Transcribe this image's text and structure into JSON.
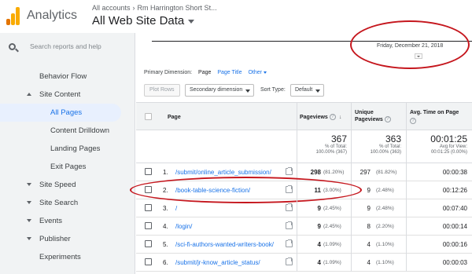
{
  "header": {
    "app_title": "Analytics",
    "account_crumb": "All accounts",
    "property_crumb": "Rm Harrington Short St...",
    "view_name": "All Web Site Data",
    "logo_colors": [
      "#f9ab00",
      "#e37400",
      "#e37400"
    ]
  },
  "sidebar": {
    "search_placeholder": "Search reports and help",
    "items": [
      {
        "label": "Behavior Flow",
        "level": "item"
      },
      {
        "label": "Site Content",
        "level": "group",
        "expanded": true
      },
      {
        "label": "All Pages",
        "level": "sub",
        "active": true
      },
      {
        "label": "Content Drilldown",
        "level": "sub"
      },
      {
        "label": "Landing Pages",
        "level": "sub"
      },
      {
        "label": "Exit Pages",
        "level": "sub"
      },
      {
        "label": "Site Speed",
        "level": "group"
      },
      {
        "label": "Site Search",
        "level": "group"
      },
      {
        "label": "Events",
        "level": "group"
      },
      {
        "label": "Publisher",
        "level": "group"
      },
      {
        "label": "Experiments",
        "level": "item"
      }
    ]
  },
  "chart": {
    "tooltip_date": "Friday, December 21, 2018"
  },
  "dimension": {
    "label": "Primary Dimension:",
    "selected": "Page",
    "option_title": "Page Title",
    "option_other": "Other"
  },
  "controls": {
    "plot_rows": "Plot Rows",
    "secondary_dimension": "Secondary dimension",
    "sort_type_label": "Sort Type:",
    "sort_type_value": "Default"
  },
  "table": {
    "columns": {
      "page": "Page",
      "pageviews": "Pageviews",
      "unique_pageviews_1": "Unique",
      "unique_pageviews_2": "Pageviews",
      "avg_time": "Avg. Time on Page",
      "help": "?"
    },
    "totals": {
      "pageviews": "367",
      "pageviews_pct": "% of Total:",
      "pageviews_pct2": "100.00% (367)",
      "unique": "363",
      "unique_pct": "% of Total:",
      "unique_pct2": "100.00% (363)",
      "avg_time": "00:01:25",
      "avg_time_pct": "Avg for View:",
      "avg_time_pct2": "00:01:25 (0.00%)"
    },
    "rows": [
      {
        "n": "1.",
        "page": "/submit/online_article_submission/",
        "pv": "298",
        "pv_pct": "(81.20%)",
        "upv": "297",
        "upv_pct": "(81.82%)",
        "time": "00:00:38"
      },
      {
        "n": "2.",
        "page": "/book-table-science-fiction/",
        "pv": "11",
        "pv_pct": "(3.00%)",
        "upv": "9",
        "upv_pct": "(2.48%)",
        "time": "00:12:26"
      },
      {
        "n": "3.",
        "page": "/",
        "pv": "9",
        "pv_pct": "(2.45%)",
        "upv": "9",
        "upv_pct": "(2.48%)",
        "time": "00:07:40"
      },
      {
        "n": "4.",
        "page": "/login/",
        "pv": "9",
        "pv_pct": "(2.45%)",
        "upv": "8",
        "upv_pct": "(2.20%)",
        "time": "00:00:14"
      },
      {
        "n": "5.",
        "page": "/sci-fi-authors-wanted-writers-book/",
        "pv": "4",
        "pv_pct": "(1.09%)",
        "upv": "4",
        "upv_pct": "(1.10%)",
        "time": "00:00:16"
      },
      {
        "n": "6.",
        "page": "/submit/jr-know_article_status/",
        "pv": "4",
        "pv_pct": "(1.09%)",
        "upv": "4",
        "upv_pct": "(1.10%)",
        "time": "00:00:03"
      }
    ]
  },
  "annotation_color": "#c5161d"
}
